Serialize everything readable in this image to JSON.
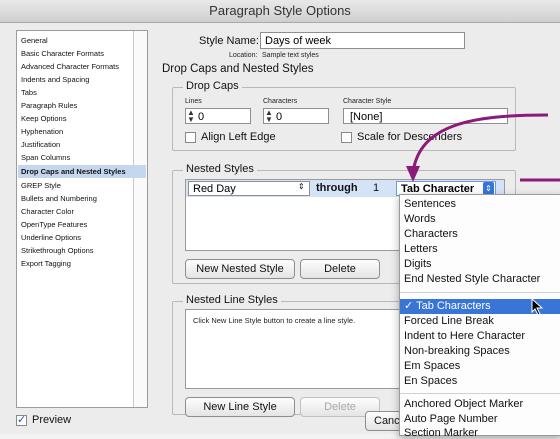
{
  "window": {
    "title": "Paragraph Style Options"
  },
  "sidebar": {
    "items": [
      {
        "label": "General"
      },
      {
        "label": "Basic Character Formats"
      },
      {
        "label": "Advanced Character Formats"
      },
      {
        "label": "Indents and Spacing"
      },
      {
        "label": "Tabs"
      },
      {
        "label": "Paragraph Rules"
      },
      {
        "label": "Keep Options"
      },
      {
        "label": "Hyphenation"
      },
      {
        "label": "Justification"
      },
      {
        "label": "Span Columns"
      },
      {
        "label": "Drop Caps and Nested Styles",
        "selected": true
      },
      {
        "label": "GREP Style"
      },
      {
        "label": "Bullets and Numbering"
      },
      {
        "label": "Character Color"
      },
      {
        "label": "OpenType Features"
      },
      {
        "label": "Underline Options"
      },
      {
        "label": "Strikethrough Options"
      },
      {
        "label": "Export Tagging"
      }
    ]
  },
  "main": {
    "style_name_label": "Style Name:",
    "style_name_value": "Days of week",
    "location_label": "Location:",
    "location_value": "Sample text styles",
    "section_title": "Drop Caps and Nested Styles",
    "drop_caps": {
      "title": "Drop Caps",
      "lines_label": "Lines",
      "lines_value": "0",
      "characters_label": "Characters",
      "characters_value": "0",
      "char_style_label": "Character Style",
      "char_style_value": "[None]",
      "align_left_edge": "Align Left Edge",
      "scale_for_descenders": "Scale for Descenders"
    },
    "nested_styles": {
      "title": "Nested Styles",
      "row": {
        "style": "Red Day",
        "through": "through",
        "count": "1",
        "delimiter": "Tab Character"
      },
      "new_button": "New Nested Style",
      "delete_button": "Delete"
    },
    "nested_line_styles": {
      "title": "Nested Line Styles",
      "hint": "Click New Line Style button to create a line style.",
      "new_button": "New Line Style",
      "delete_button": "Delete"
    },
    "preview_label": "Preview",
    "preview_checked": true,
    "cancel_button": "Canc"
  },
  "dropdown": {
    "group1": [
      "Sentences",
      "Words",
      "Characters",
      "Letters",
      "Digits",
      "End Nested Style Character"
    ],
    "group2": [
      {
        "label": "✓ Tab Characters",
        "selected": true
      },
      {
        "label": "Forced Line Break"
      },
      {
        "label": "Indent to Here Character"
      },
      {
        "label": "Non-breaking Spaces"
      },
      {
        "label": "Em Spaces"
      },
      {
        "label": "En Spaces"
      }
    ],
    "group3": [
      "Anchored Object Marker",
      "Auto Page Number",
      "Section Marker"
    ]
  },
  "colors": {
    "annotation_arrow": "#8b1a7a",
    "menu_highlight": "#3875d7",
    "sidebar_selected": "#c5d7ef"
  }
}
